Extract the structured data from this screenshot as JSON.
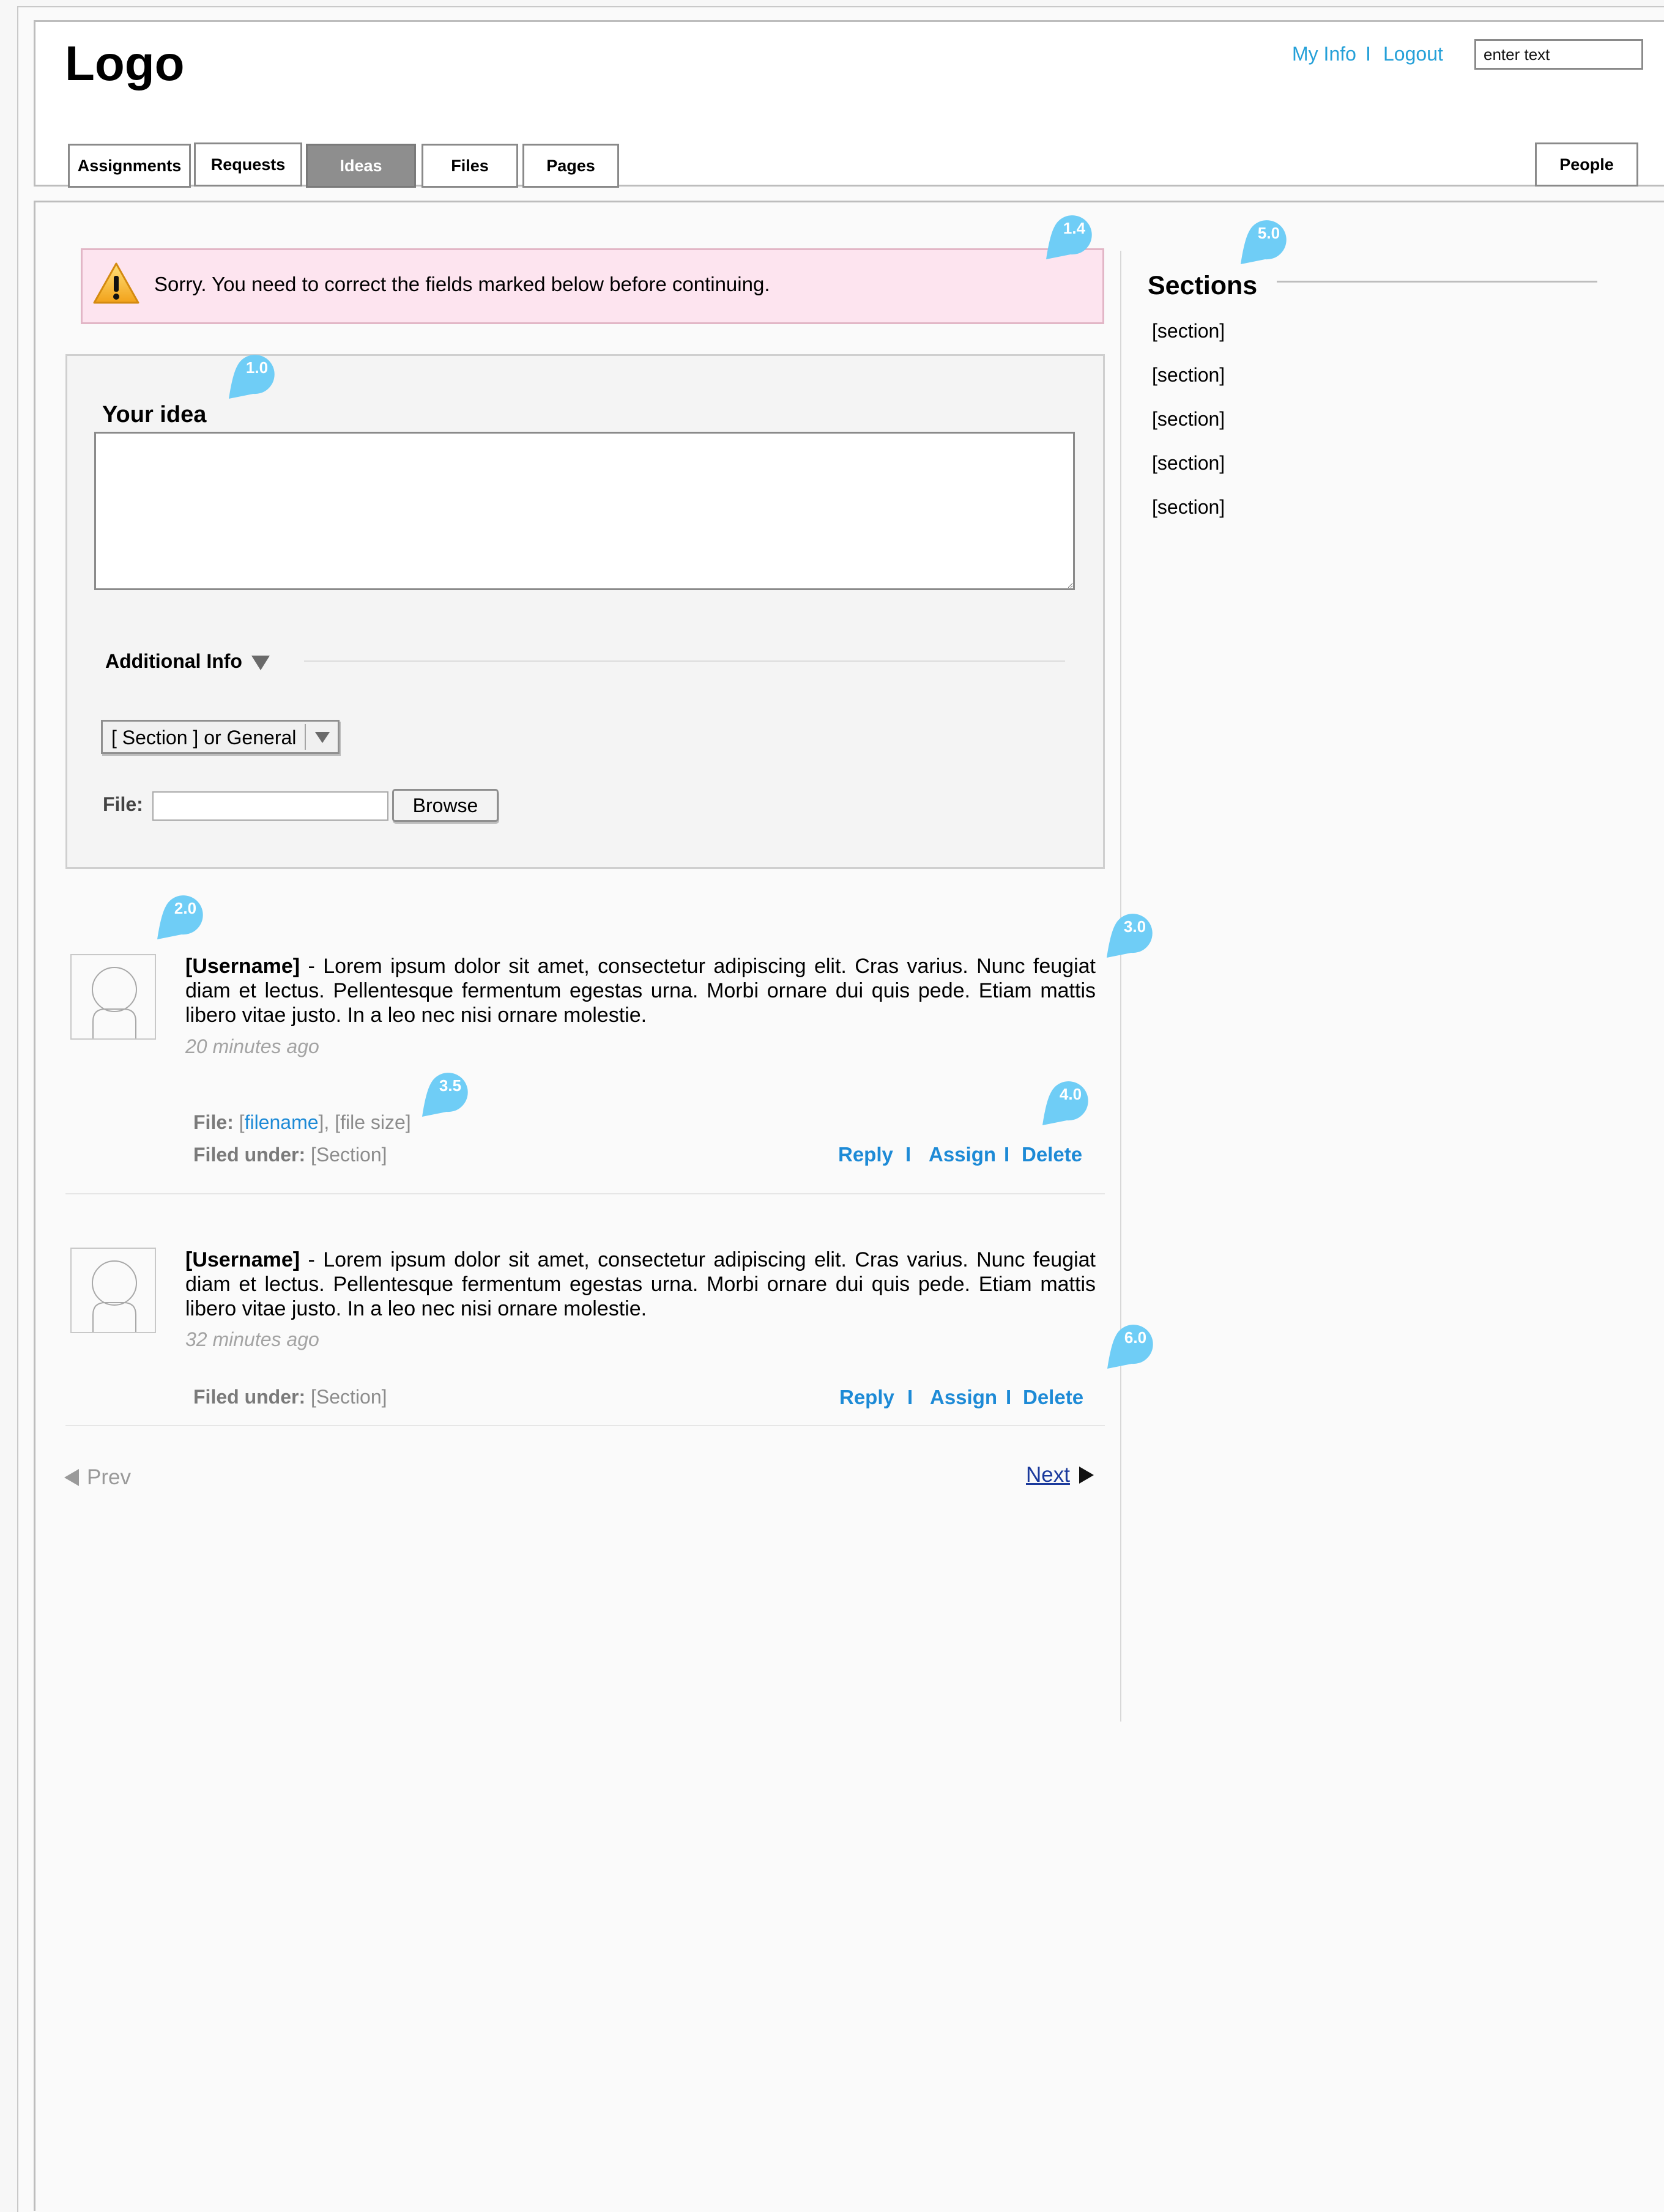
{
  "header": {
    "logo": "Logo",
    "links": {
      "my_info": "My Info",
      "separator": "I",
      "logout": "Logout"
    },
    "search": {
      "value": "enter text"
    },
    "tabs": [
      {
        "label": "Assignments",
        "active": false
      },
      {
        "label": "Requests",
        "active": false
      },
      {
        "label": "Ideas",
        "active": true
      },
      {
        "label": "Files",
        "active": false
      },
      {
        "label": "Pages",
        "active": false
      }
    ],
    "people_tab": "People"
  },
  "alert": {
    "message": "Sorry. You need to correct the fields marked below before continuing."
  },
  "idea_form": {
    "heading": "Your idea",
    "textarea_value": "",
    "additional_info": "Additional Info",
    "section_select": "[ Section ] or General",
    "file_label": "File:",
    "browse": "Browse"
  },
  "posts": [
    {
      "username": "[Username]",
      "body": " - Lorem ipsum dolor sit amet, consectetur adipiscing elit. Cras varius. Nunc feugiat diam et lectus. Pellentesque fermentum egestas urna. Morbi ornare dui quis pede. Etiam mattis libero vitae justo. In a leo nec nisi ornare molestie.",
      "time": "20 minutes ago",
      "file": {
        "label": "File:",
        "open_bracket": "[",
        "name": "filename",
        "rest": "], [file size]"
      },
      "filed_label": "Filed under:",
      "filed_value": "[Section]",
      "actions": {
        "reply": "Reply",
        "separator": "I",
        "assign": "Assign",
        "delete": "Delete"
      }
    },
    {
      "username": "[Username]",
      "body": " - Lorem ipsum dolor sit amet, consectetur adipiscing elit. Cras varius. Nunc feugiat diam et lectus. Pellentesque fermentum egestas urna. Morbi ornare dui quis pede. Etiam mattis libero vitae justo. In a leo nec nisi ornare molestie.",
      "time": "32 minutes ago",
      "filed_label": "Filed under:",
      "filed_value": "[Section]",
      "actions": {
        "reply": "Reply",
        "separator": "I",
        "assign": "Assign",
        "delete": "Delete"
      }
    }
  ],
  "pager": {
    "prev": "Prev",
    "next": "Next"
  },
  "sidebar": {
    "title": "Sections",
    "items": [
      "[section]",
      "[section]",
      "[section]",
      "[section]",
      "[section]"
    ]
  },
  "annotations": [
    "1.4",
    "5.0",
    "1.0",
    "2.0",
    "3.0",
    "3.5",
    "4.0",
    "6.0"
  ],
  "colors": {
    "link": "#24a0d8",
    "action": "#1d8ad6",
    "pin": "#6fcdf6",
    "alert_bg": "#fde4ef",
    "active_tab": "#8e8e8e"
  }
}
